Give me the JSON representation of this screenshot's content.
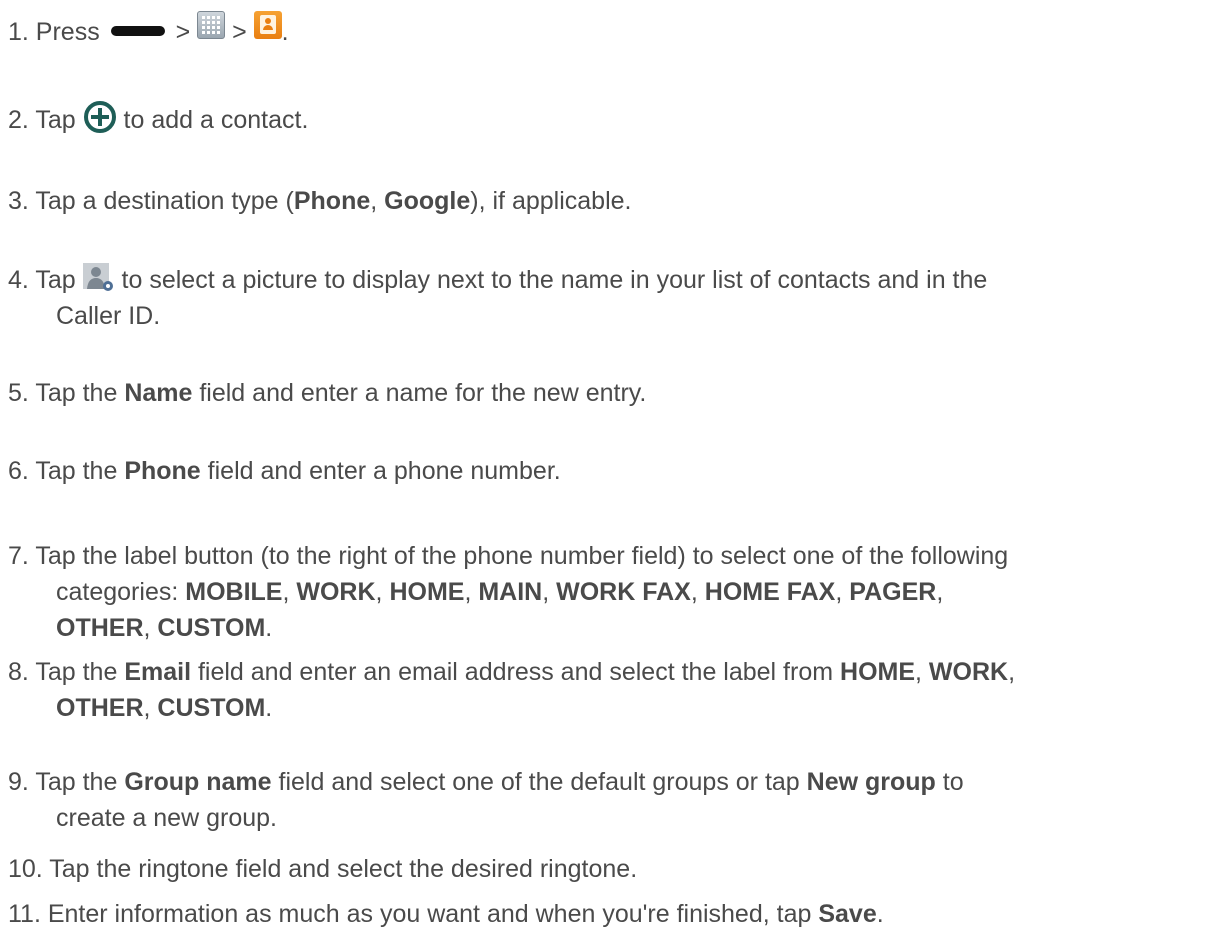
{
  "steps": [
    {
      "num": "1.",
      "parts": [
        {
          "t": " Press "
        },
        {
          "icon": "home-key"
        },
        {
          "t": " > "
        },
        {
          "icon": "apps-icon"
        },
        {
          "t": " > "
        },
        {
          "icon": "contacts-icon"
        },
        {
          "t": "."
        }
      ]
    },
    {
      "num": "2.",
      "parts": [
        {
          "t": " Tap "
        },
        {
          "icon": "add-contact-icon"
        },
        {
          "t": " to add a contact."
        }
      ]
    },
    {
      "num": "3.",
      "parts": [
        {
          "t": " Tap a destination type ("
        },
        {
          "b": "Phone"
        },
        {
          "t": ", "
        },
        {
          "b": "Google"
        },
        {
          "t": "), if applicable."
        }
      ]
    },
    {
      "num": "4.",
      "parts": [
        {
          "t": " Tap "
        },
        {
          "icon": "contact-photo-icon"
        },
        {
          "t": " to select a picture to display next to the name in your list of contacts and in the"
        }
      ],
      "cont": [
        {
          "t": "Caller ID."
        }
      ]
    },
    {
      "num": "5.",
      "parts": [
        {
          "t": " Tap the "
        },
        {
          "b": "Name"
        },
        {
          "t": " field and enter a name for the new entry."
        }
      ]
    },
    {
      "num": "6.",
      "parts": [
        {
          "t": " Tap the "
        },
        {
          "b": "Phone"
        },
        {
          "t": " field and enter a phone number."
        }
      ]
    },
    {
      "num": "7.",
      "parts": [
        {
          "t": " Tap the label button (to the right of the phone number field) to select one of the following"
        }
      ],
      "cont": [
        {
          "t": "categories: "
        },
        {
          "b": "MOBILE"
        },
        {
          "t": ", "
        },
        {
          "b": "WORK"
        },
        {
          "t": ", "
        },
        {
          "b": "HOME"
        },
        {
          "t": ", "
        },
        {
          "b": "MAIN"
        },
        {
          "t": ", "
        },
        {
          "b": "WORK FAX"
        },
        {
          "t": ", "
        },
        {
          "b": "HOME FAX"
        },
        {
          "t": ", "
        },
        {
          "b": "PAGER"
        },
        {
          "t": ","
        }
      ],
      "cont2": [
        {
          "b": "OTHER"
        },
        {
          "t": ", "
        },
        {
          "b": "CUSTOM"
        },
        {
          "t": "."
        }
      ]
    },
    {
      "num": "8.",
      "parts": [
        {
          "t": " Tap the "
        },
        {
          "b": "Email"
        },
        {
          "t": " field and enter an email address and select the label from "
        },
        {
          "b": "HOME"
        },
        {
          "t": ", "
        },
        {
          "b": "WORK"
        },
        {
          "t": ","
        }
      ],
      "cont": [
        {
          "b": "OTHER"
        },
        {
          "t": ", "
        },
        {
          "b": "CUSTOM"
        },
        {
          "t": "."
        }
      ]
    },
    {
      "num": "9.",
      "parts": [
        {
          "t": " Tap the "
        },
        {
          "b": "Group name"
        },
        {
          "t": " field and select one of the default groups or tap "
        },
        {
          "b": "New group"
        },
        {
          "t": " to"
        }
      ],
      "cont": [
        {
          "t": "create a new group."
        }
      ]
    },
    {
      "num": "10.",
      "parts": [
        {
          "t": " Tap the ringtone field and select the desired ringtone."
        }
      ]
    },
    {
      "num": "11.",
      "parts": [
        {
          "t": " Enter information as much as you want and when you're finished, tap "
        },
        {
          "b": "Save"
        },
        {
          "t": "."
        }
      ]
    }
  ]
}
